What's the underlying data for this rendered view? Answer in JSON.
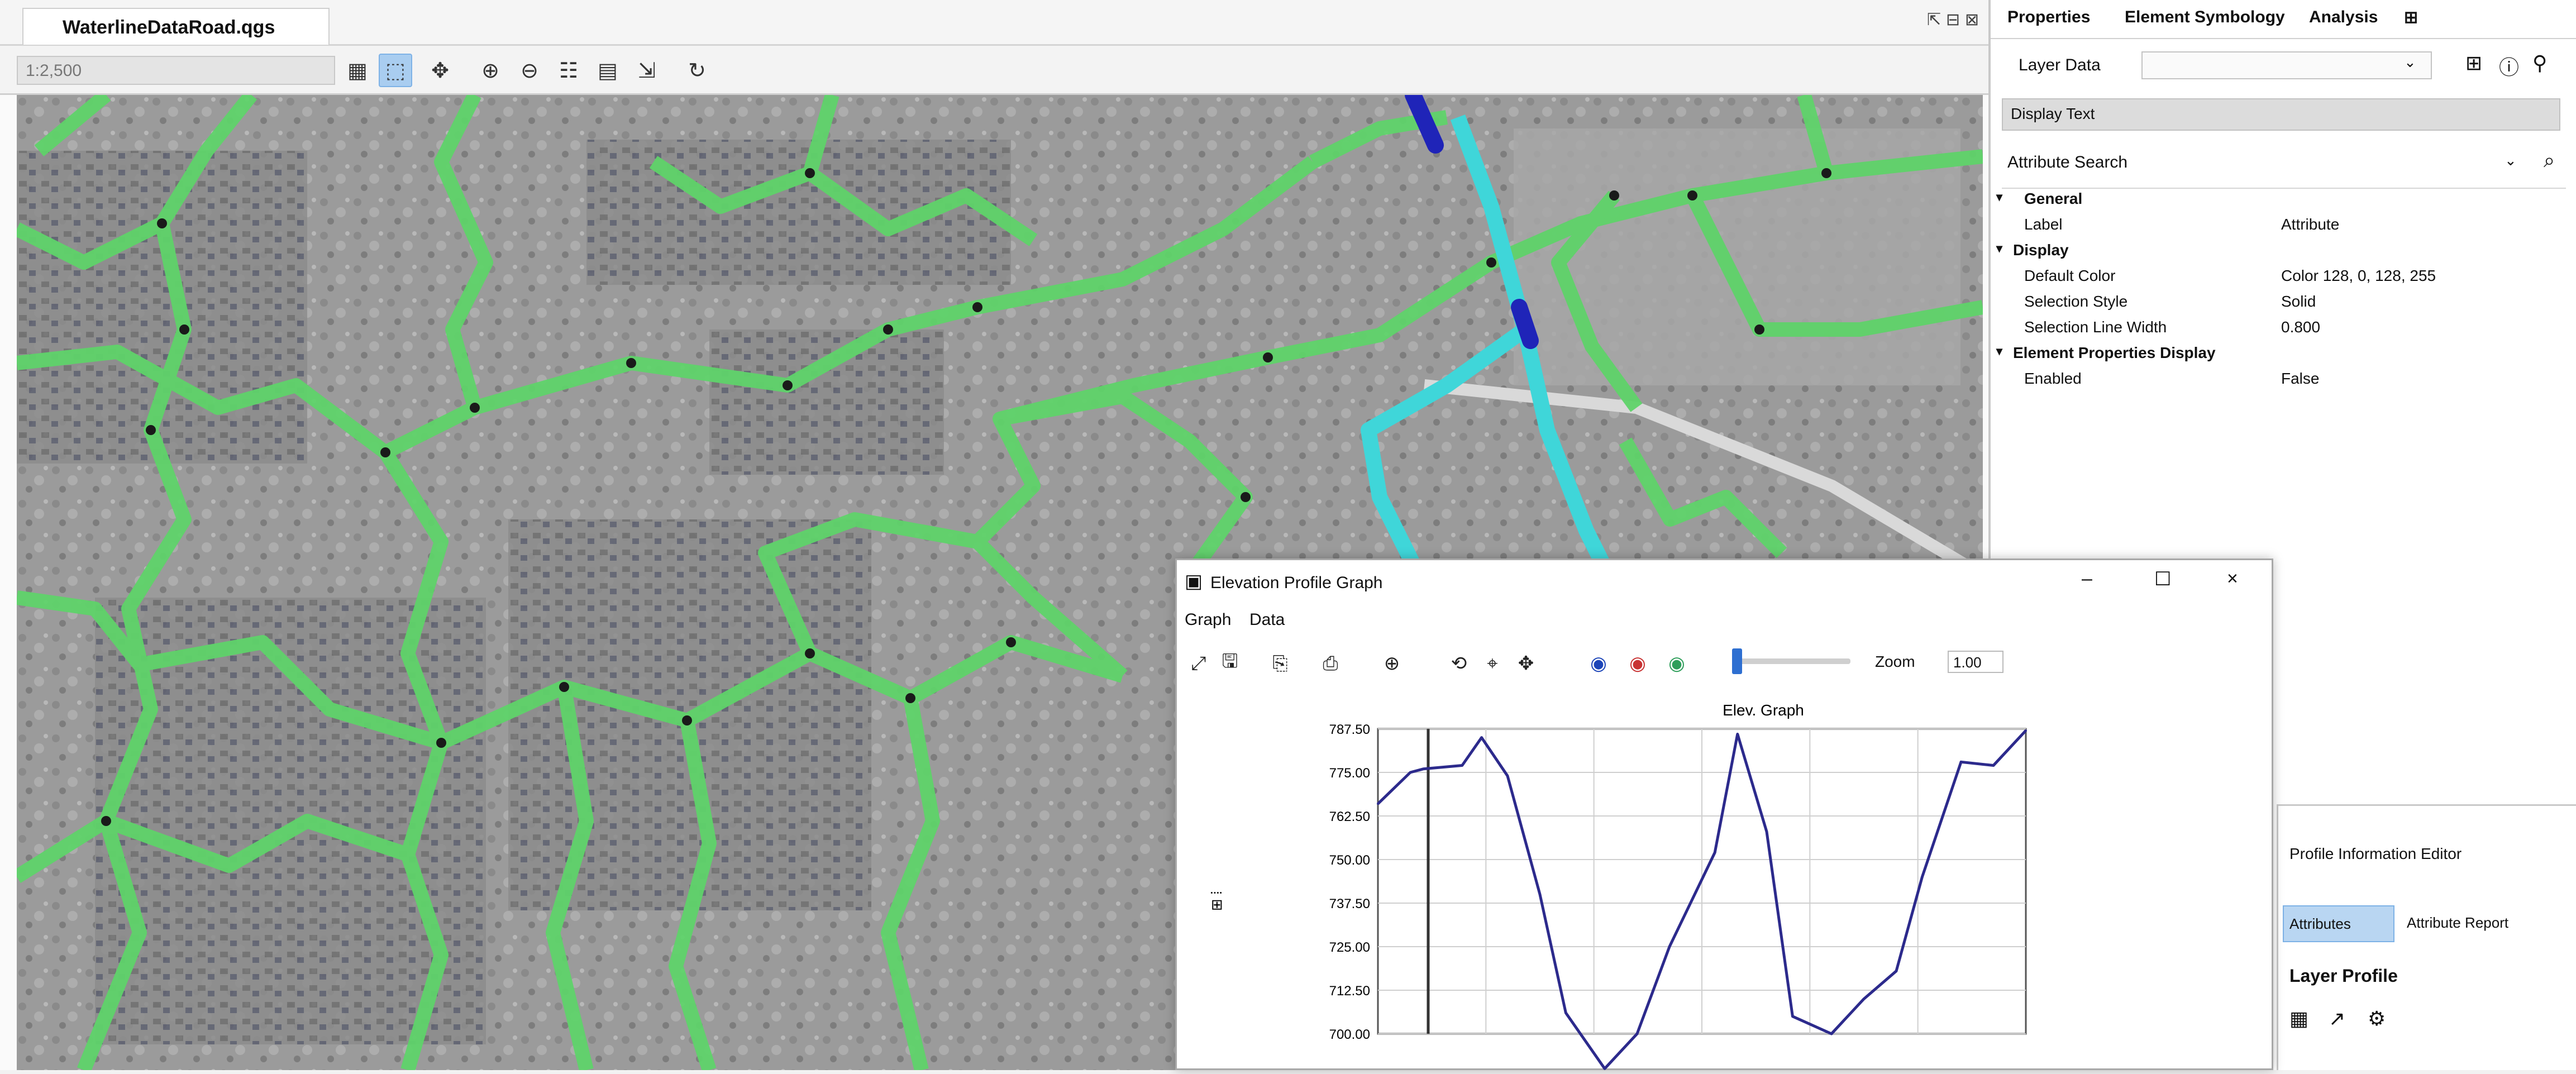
{
  "map_window": {
    "tab_title": "WaterlineDataRoad.qgs",
    "scale_text": "1:2,500",
    "window_controls": [
      "⇱",
      "⊟",
      "⊠"
    ]
  },
  "properties_panel": {
    "tabs": [
      "Properties",
      "Element Symbology",
      "Analysis",
      "⊞"
    ],
    "layer_label": "Layer Data",
    "filter_text": "Display Text",
    "search_label": "Attribute Search",
    "tree": [
      {
        "key": "General",
        "value": "",
        "bold": true,
        "caret": true
      },
      {
        "key": "Label",
        "value": "Attribute",
        "bold": false,
        "caret": false
      },
      {
        "key": "Display",
        "value": "",
        "bold": true,
        "caret": true
      },
      {
        "key": "Default Color",
        "value": "Color 128, 0, 128, 255",
        "bold": false,
        "caret": false
      },
      {
        "key": "Selection Style",
        "value": "Solid",
        "bold": false,
        "caret": false
      },
      {
        "key": "Selection Line Width",
        "value": "0.800",
        "bold": false,
        "caret": false
      },
      {
        "key": "Element Properties Display",
        "value": "",
        "bold": true,
        "caret": true
      },
      {
        "key": "Enabled",
        "value": "False",
        "bold": false,
        "caret": false
      }
    ]
  },
  "graph_window": {
    "title": "Elevation Profile Graph",
    "menu": [
      "Graph",
      "Data"
    ],
    "zoom_label": "Zoom",
    "zoom_value": "1.00",
    "chart_title": "Elev. Graph"
  },
  "small_panel": {
    "title": "Profile Information Editor",
    "tab_a": "Attributes",
    "tab_b": "Attribute Report",
    "heading": "Layer Profile"
  },
  "colors": {
    "pipe_green": "#5fd36a",
    "pipe_cyan": "#3fd6d9",
    "pipe_blue": "#1f24b8",
    "graph_line": "#2c2a8c"
  },
  "chart_data": {
    "type": "line",
    "title": "Elev. Graph",
    "y_tick_labels": [
      "700.00",
      "712.50",
      "725.00",
      "737.50",
      "750.00",
      "762.50",
      "775.00",
      "787.50"
    ],
    "ylim": [
      700,
      787.5
    ],
    "xlim": [
      0,
      1
    ],
    "grid": true,
    "series": [
      {
        "x": [
          0,
          0.05,
          0.07,
          0.13,
          0.16,
          0.2,
          0.25,
          0.29,
          0.35,
          0.4,
          0.45,
          0.52,
          0.555,
          0.6,
          0.64,
          0.7,
          0.75,
          0.8,
          0.84,
          0.9,
          0.95,
          1.0
        ],
        "y": [
          766,
          775,
          776,
          777,
          785,
          774,
          740,
          706,
          690,
          700,
          725,
          752,
          786,
          758,
          705,
          700,
          710,
          718,
          745,
          778,
          777,
          787
        ]
      }
    ]
  }
}
